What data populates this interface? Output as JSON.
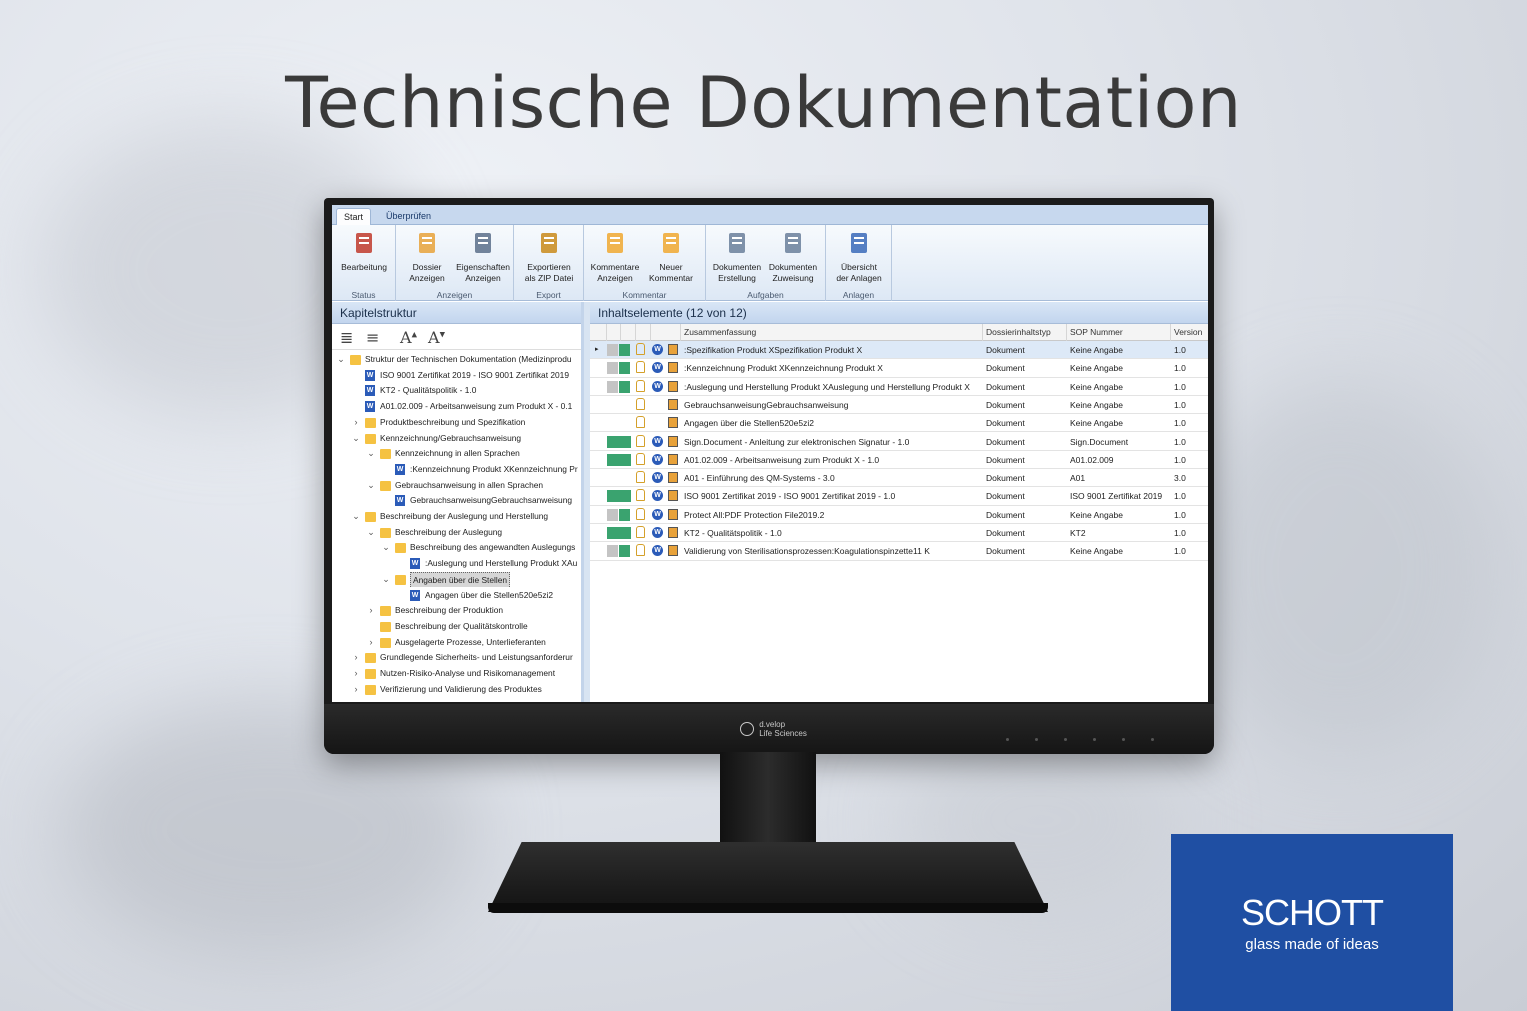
{
  "headline": "Technische Dokumentation",
  "ribbon": {
    "tabs": [
      "Start",
      "Überprüfen"
    ],
    "groups": [
      {
        "title": "Status",
        "buttons": [
          "Bearbeitung"
        ]
      },
      {
        "title": "Anzeigen",
        "buttons": [
          "Dossier\nAnzeigen",
          "Eigenschaften\nAnzeigen"
        ]
      },
      {
        "title": "Export",
        "buttons": [
          "Exportieren\nals ZIP Datei"
        ]
      },
      {
        "title": "Kommentar",
        "buttons": [
          "Kommentare\nAnzeigen",
          "Neuer\nKommentar"
        ]
      },
      {
        "title": "Aufgaben",
        "buttons": [
          "Dokumenten\nErstellung",
          "Dokumenten\nZuweisung"
        ]
      },
      {
        "title": "Anlagen",
        "buttons": [
          "Übersicht\nder Anlagen"
        ]
      }
    ]
  },
  "left_pane": {
    "title": "Kapitelstruktur",
    "tree": [
      {
        "label": "Struktur der Technischen Dokumentation (Medizinprodu",
        "level": 0,
        "type": "folder",
        "chev": "v"
      },
      {
        "label": "ISO 9001 Zertifikat 2019 - ISO 9001 Zertifikat 2019",
        "level": 1,
        "type": "doc",
        "chev": ""
      },
      {
        "label": "KT2 - Qualitätspolitik - 1.0",
        "level": 1,
        "type": "doc",
        "chev": ""
      },
      {
        "label": "A01.02.009 - Arbeitsanweisung zum Produkt X - 0.1",
        "level": 1,
        "type": "doc",
        "chev": ""
      },
      {
        "label": "Produktbeschreibung und Spezifikation",
        "level": 1,
        "type": "folder",
        "chev": ">"
      },
      {
        "label": "Kennzeichnung/Gebrauchsanweisung",
        "level": 1,
        "type": "folder",
        "chev": "v"
      },
      {
        "label": "Kennzeichnung in allen Sprachen",
        "level": 2,
        "type": "folder",
        "chev": "v"
      },
      {
        "label": ":Kennzeichnung Produkt XKennzeichnung Pr",
        "level": 3,
        "type": "doc",
        "chev": ""
      },
      {
        "label": "Gebrauchsanweisung in allen Sprachen",
        "level": 2,
        "type": "folder",
        "chev": "v"
      },
      {
        "label": "GebrauchsanweisungGebrauchsanweisung",
        "level": 3,
        "type": "doc",
        "chev": ""
      },
      {
        "label": "Beschreibung der Auslegung und Herstellung",
        "level": 1,
        "type": "folder",
        "chev": "v"
      },
      {
        "label": "Beschreibung der Auslegung",
        "level": 2,
        "type": "folder",
        "chev": "v"
      },
      {
        "label": "Beschreibung des angewandten Auslegungs",
        "level": 3,
        "type": "folder",
        "chev": "v"
      },
      {
        "label": ":Auslegung und Herstellung Produkt XAu",
        "level": 4,
        "type": "doc",
        "chev": ""
      },
      {
        "label": "Angaben über die Stellen",
        "level": 3,
        "type": "folder",
        "chev": "v",
        "selected": true
      },
      {
        "label": "Angagen über die Stellen520e5zi2",
        "level": 4,
        "type": "doc",
        "chev": ""
      },
      {
        "label": "Beschreibung der Produktion",
        "level": 2,
        "type": "folder",
        "chev": ">"
      },
      {
        "label": "Beschreibung der Qualitätskontrolle",
        "level": 2,
        "type": "folder",
        "chev": ""
      },
      {
        "label": "Ausgelagerte Prozesse, Unterlieferanten",
        "level": 2,
        "type": "folder",
        "chev": ">"
      },
      {
        "label": "Grundlegende Sicherheits- und Leistungsanforderur",
        "level": 1,
        "type": "folder",
        "chev": ">"
      },
      {
        "label": "Nutzen-Risiko-Analyse und Risikomanagement",
        "level": 1,
        "type": "folder",
        "chev": ">"
      },
      {
        "label": "Verifizierung und Validierung des Produktes",
        "level": 1,
        "type": "folder",
        "chev": ">"
      }
    ]
  },
  "right_pane": {
    "title": "Inhaltselemente (12 von 12)",
    "columns": [
      "Zusammenfassung",
      "Dossierinhaltstyp",
      "SOP Nummer",
      "Version"
    ],
    "rows": [
      {
        "summary": ":Spezifikation Produkt XSpezifikation Produkt X",
        "type": "Dokument",
        "sop": "Keine Angabe",
        "version": "1.0",
        "status": "gray-green"
      },
      {
        "summary": ":Kennzeichnung Produkt XKennzeichnung Produkt X",
        "type": "Dokument",
        "sop": "Keine Angabe",
        "version": "1.0",
        "status": "gray-green"
      },
      {
        "summary": ":Auslegung und Herstellung Produkt XAuslegung und Herstellung Produkt X",
        "type": "Dokument",
        "sop": "Keine Angabe",
        "version": "1.0",
        "status": "gray-green"
      },
      {
        "summary": "GebrauchsanweisungGebrauchsanweisung",
        "type": "Dokument",
        "sop": "Keine Angabe",
        "version": "1.0",
        "status": "none"
      },
      {
        "summary": "Angagen über die Stellen520e5zi2",
        "type": "Dokument",
        "sop": "Keine Angabe",
        "version": "1.0",
        "status": "none"
      },
      {
        "summary": "Sign.Document - Anleitung zur elektronischen Signatur - 1.0",
        "type": "Dokument",
        "sop": "Sign.Document",
        "version": "1.0",
        "status": "green"
      },
      {
        "summary": "A01.02.009 - Arbeitsanweisung zum Produkt X - 1.0",
        "type": "Dokument",
        "sop": "A01.02.009",
        "version": "1.0",
        "status": "green"
      },
      {
        "summary": "A01 - Einführung des QM-Systems - 3.0",
        "type": "Dokument",
        "sop": "A01",
        "version": "3.0",
        "status": "none"
      },
      {
        "summary": "ISO 9001 Zertifikat 2019 - ISO 9001 Zertifikat 2019 - 1.0",
        "type": "Dokument",
        "sop": "ISO 9001 Zertifikat 2019",
        "version": "1.0",
        "status": "green"
      },
      {
        "summary": "Protect All:PDF Protection File2019.2",
        "type": "Dokument",
        "sop": "Keine Angabe",
        "version": "1.0",
        "status": "gray-green"
      },
      {
        "summary": "KT2 - Qualitätspolitik - 1.0",
        "type": "Dokument",
        "sop": "KT2",
        "version": "1.0",
        "status": "green"
      },
      {
        "summary": "Validierung von Sterilisationsprozessen:Koagulationspinzette11 K",
        "type": "Dokument",
        "sop": "Keine Angabe",
        "version": "1.0",
        "status": "gray-green"
      }
    ]
  },
  "monitor_brand": {
    "line1": "d.velop",
    "line2": "Life Sciences"
  },
  "schott": {
    "name": "SCHOTT",
    "slogan": "glass made of ideas",
    "color": "#1f4fa3"
  }
}
